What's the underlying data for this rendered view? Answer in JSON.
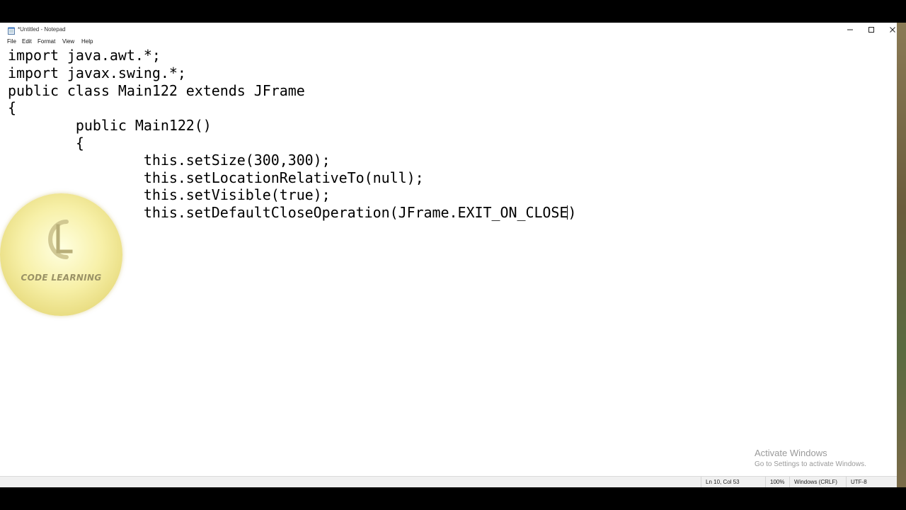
{
  "window": {
    "title": "*Untitled - Notepad",
    "icon": "notepad-icon"
  },
  "menu": [
    "File",
    "Edit",
    "Format",
    "View",
    "Help"
  ],
  "editor": {
    "lines": [
      "import java.awt.*;",
      "import javax.swing.*;",
      "public class Main122 extends JFrame",
      "{",
      "        public Main122()",
      "        {",
      "                this.setSize(300,300);",
      "                this.setLocationRelativeTo(null);",
      "                this.setVisible(true);"
    ],
    "caret_line_before": "                this.setDefaultCloseOperation(JFrame.EXIT_ON_CLOSE",
    "caret_line_after": ")"
  },
  "status": {
    "position": "Ln 10, Col 53",
    "zoom": "100%",
    "line_ending": "Windows (CRLF)",
    "encoding": "UTF-8"
  },
  "watermark": {
    "title": "Activate Windows",
    "subtitle": "Go to Settings to activate Windows."
  },
  "logo": {
    "text": "CODE LEARNING"
  }
}
